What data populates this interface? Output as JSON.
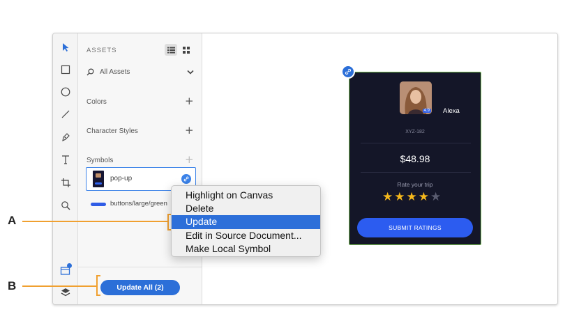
{
  "assets_panel": {
    "title": "ASSETS",
    "search_label": "All Assets",
    "sections": {
      "colors": "Colors",
      "character_styles": "Character Styles",
      "symbols": "Symbols"
    },
    "symbols": [
      {
        "name": "pop-up"
      },
      {
        "name": "buttons/large/green"
      }
    ],
    "update_all_label": "Update All (2)"
  },
  "context_menu": {
    "items": [
      {
        "label": "Highlight on Canvas",
        "active": false
      },
      {
        "label": "Delete",
        "active": false
      },
      {
        "label": "Update",
        "active": true
      },
      {
        "label": "Edit in Source Document...",
        "active": false
      },
      {
        "label": "Make Local Symbol",
        "active": false
      }
    ]
  },
  "artboard": {
    "user_name": "Alexa",
    "rating_badge": "4.9",
    "code": "XYZ-182",
    "price": "$48.98",
    "rate_prompt": "Rate your trip",
    "stars_filled": 4,
    "stars_total": 5,
    "submit_label": "SUBMIT RATINGS"
  },
  "callouts": {
    "a": "A",
    "b": "B"
  },
  "colors": {
    "accent": "#2c6fd8",
    "callout": "#f0a030",
    "artboard_bg": "#141628",
    "artboard_border": "#79c152",
    "star_filled": "#f5b81c",
    "star_empty": "#5a5c70"
  }
}
